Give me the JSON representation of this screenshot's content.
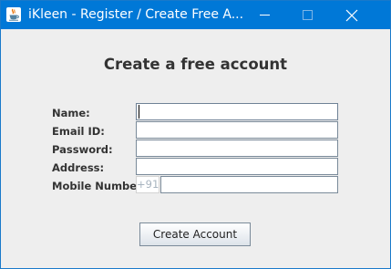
{
  "window": {
    "title": "iKleen - Register / Create Free A...",
    "app_icon": "java-cup-icon",
    "controls": {
      "minimize_icon": "minimize-icon",
      "maximize_icon": "maximize-icon",
      "close_icon": "close-icon"
    }
  },
  "form": {
    "heading": "Create a free account",
    "fields": {
      "name": {
        "label": "Name:",
        "value": ""
      },
      "email": {
        "label": "Email ID:",
        "value": ""
      },
      "password": {
        "label": "Password:",
        "value": ""
      },
      "address": {
        "label": "Address:",
        "value": ""
      },
      "mobile": {
        "label": "Mobile Number:",
        "prefix": "+91",
        "value": ""
      }
    },
    "submit_label": "Create Account"
  },
  "colors": {
    "titlebar": "#0078d7",
    "content_background": "#eeeeee",
    "field_border": "#7a8a99",
    "text": "#333333"
  }
}
